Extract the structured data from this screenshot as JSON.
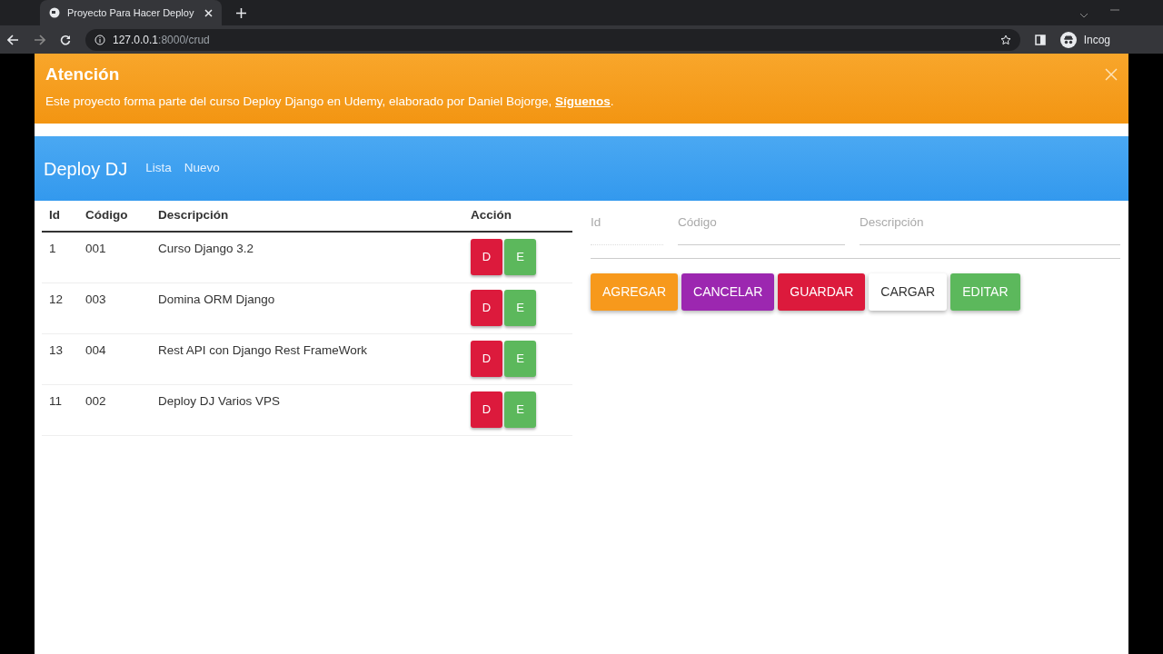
{
  "browser": {
    "tab_title": "Proyecto Para Hacer Deploy",
    "url_host": "127.0.0.1",
    "url_path": ":8000/crud",
    "profile_label": "Incog"
  },
  "alert": {
    "title": "Atención",
    "text": "Este proyecto forma parte del curso Deploy Django en Udemy, elaborado por Daniel Bojorge, ",
    "link": "Síguenos",
    "text_end": "."
  },
  "navbar": {
    "brand": "Deploy DJ",
    "links": [
      "Lista",
      "Nuevo"
    ]
  },
  "table": {
    "columns": [
      "Id",
      "Código",
      "Descripción",
      "Acción"
    ],
    "rows": [
      {
        "cells": [
          "1",
          "001",
          "Curso Django 3.2"
        ],
        "actions": [
          "D",
          "E"
        ]
      },
      {
        "cells": [
          "12",
          "003",
          "Domina ORM Django"
        ],
        "actions": [
          "D",
          "E"
        ]
      },
      {
        "cells": [
          "13",
          "004",
          "Rest API con Django Rest FrameWork"
        ],
        "actions": [
          "D",
          "E"
        ]
      },
      {
        "cells": [
          "11",
          "002",
          "Deploy DJ Varios VPS"
        ],
        "actions": [
          "D",
          "E"
        ]
      }
    ]
  },
  "form": {
    "fields": [
      {
        "placeholder": "Id",
        "disabled": true
      },
      {
        "placeholder": "Código",
        "disabled": false
      },
      {
        "placeholder": "Descripción",
        "disabled": false
      }
    ],
    "buttons": [
      {
        "label": "AGREGAR",
        "color": "#f7991c"
      },
      {
        "label": "CANCELAR",
        "color": "#9c27b0"
      },
      {
        "label": "GUARDAR",
        "color": "#dc1a3c"
      },
      {
        "label": "CARGAR",
        "color": "#ffffff"
      },
      {
        "label": "EDITAR",
        "color": "#5cb85c"
      }
    ]
  }
}
